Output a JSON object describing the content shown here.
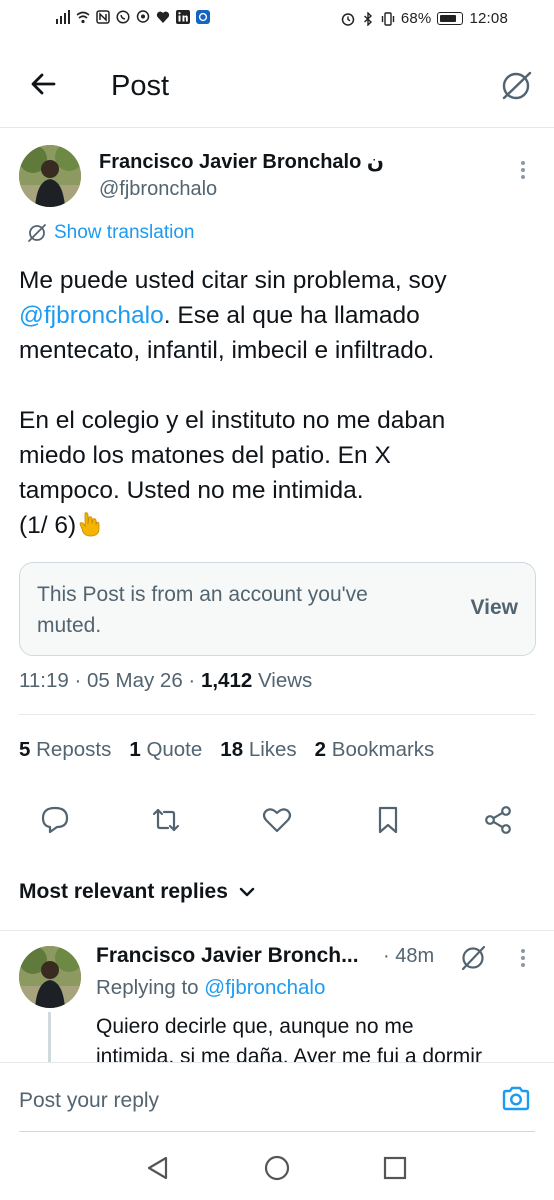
{
  "status_bar": {
    "battery": "68%",
    "time": "12:08"
  },
  "header": {
    "title": "Post"
  },
  "tweet": {
    "author_name": "Francisco Javier Bronchalo ن",
    "author_handle": "@fjbronchalo",
    "show_translation": "Show translation",
    "body": {
      "line1": "Me puede usted citar sin problema, soy",
      "mention": "@fjbronchalo",
      "line2_rest": ". Ese al que ha llamado",
      "line3": "mentecato, infantil, imbecil e infiltrado.",
      "para2_line1": "En el colegio y el instituto no me daban",
      "para2_line2": "miedo los matones del patio. En X",
      "para2_line3": "tampoco. Usted no me intimida.",
      "para2_line4": "(1/ 6)"
    },
    "muted_notice": {
      "text": "This Post is from an account you've muted.",
      "view_label": "View"
    },
    "meta": {
      "time": "11:19",
      "date": "05 May 26",
      "views_count": "1,412",
      "views_label": "Views"
    },
    "stats": {
      "reposts_count": "5",
      "reposts_label": "Reposts",
      "quotes_count": "1",
      "quotes_label": "Quote",
      "likes_count": "18",
      "likes_label": "Likes",
      "bookmarks_count": "2",
      "bookmarks_label": "Bookmarks"
    }
  },
  "actions": [
    "reply-icon",
    "repost-icon",
    "like-icon",
    "bookmark-icon",
    "share-icon"
  ],
  "replies": {
    "heading": "Most relevant replies",
    "items": [
      {
        "author_name": "Francisco Javier Bronch...",
        "time": "· 48m",
        "replying_prefix": "Replying to",
        "replying_handle": "@fjbronchalo",
        "body_line1": "Quiero decirle que, aunque no me",
        "body_line2": "intimida, si me daña. Ayer me fui a dormir"
      }
    ]
  },
  "compose": {
    "placeholder": "Post your reply"
  },
  "colors": {
    "accent": "#1d9bf0",
    "text": "#0f1419",
    "secondary": "#536471",
    "border": "#e6e9ec"
  }
}
